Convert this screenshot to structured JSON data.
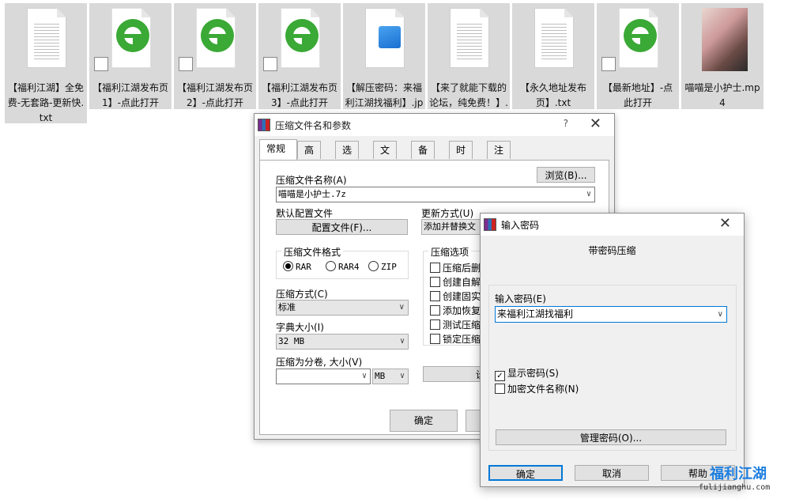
{
  "files": [
    {
      "label": "【福利江湖】全免费-无套路-更新快.txt",
      "type": "txt"
    },
    {
      "label": "【福利江湖发布页1】-点此打开",
      "type": "ie-shortcut"
    },
    {
      "label": "【福利江湖发布页2】-点此打开",
      "type": "ie-shortcut"
    },
    {
      "label": "【福利江湖发布页3】-点此打开",
      "type": "ie-shortcut"
    },
    {
      "label": "【解压密码：来福利江湖找福利】.jpg",
      "type": "image"
    },
    {
      "label": "【来了就能下载的论坛，纯免费！】.txt",
      "type": "txt"
    },
    {
      "label": "【永久地址发布页】.txt",
      "type": "txt"
    },
    {
      "label": "【最新地址】-点此打开",
      "type": "ie-shortcut"
    },
    {
      "label": "喵喵是小护士.mp4",
      "type": "video"
    }
  ],
  "archive_dialog": {
    "title": "压缩文件名和参数",
    "help": "?",
    "close": "✕",
    "tabs": [
      "常规",
      "高级",
      "选项",
      "文件",
      "备份",
      "时间",
      "注释"
    ],
    "archive_name_label": "压缩文件名称(A)",
    "browse_button": "浏览(B)...",
    "archive_name_value": "喵喵是小护士.7z",
    "default_profile_label": "默认配置文件",
    "profile_button": "配置文件(F)...",
    "update_mode_label": "更新方式(U)",
    "update_mode_value": "添加并替换文",
    "format_group": "压缩文件格式",
    "format_options": [
      "RAR",
      "RAR4",
      "ZIP"
    ],
    "format_selected": "RAR",
    "method_label": "压缩方式(C)",
    "method_value": "标准",
    "dict_label": "字典大小(I)",
    "dict_value": "32 MB",
    "split_label": "压缩为分卷, 大小(V)",
    "split_value": "",
    "split_unit": "MB",
    "options_group": "压缩选项",
    "options": [
      "压缩后删",
      "创建自解",
      "创建固实",
      "添加恢复",
      "测试压缩",
      "锁定压缩"
    ],
    "set_button_partial": "设",
    "ok_button": "确定"
  },
  "password_dialog": {
    "title": "输入密码",
    "close": "✕",
    "heading": "带密码压缩",
    "input_label": "输入密码(E)",
    "password_value": "来福利江湖找福利",
    "show_password": "显示密码(S)",
    "show_password_checked": true,
    "encrypt_names": "加密文件名称(N)",
    "encrypt_names_checked": false,
    "manage_button": "管理密码(O)...",
    "ok_button": "确定",
    "cancel_button": "取消",
    "help_button": "帮助"
  },
  "watermark": {
    "title": "福利江湖",
    "url": "fulijianghu.com"
  },
  "colors": {
    "accent": "#0078d7",
    "ie_green": "#3aa935",
    "file_bg": "#d9d9d9"
  }
}
